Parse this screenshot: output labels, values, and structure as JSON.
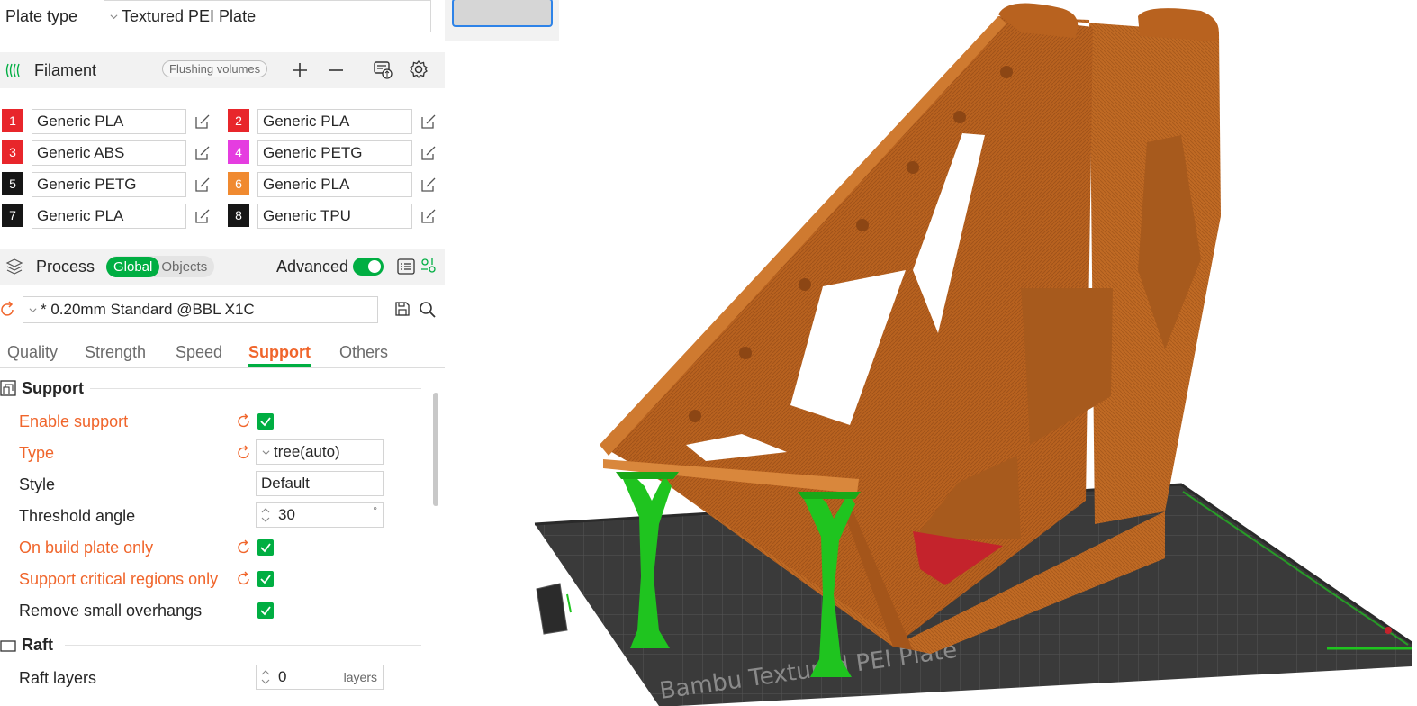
{
  "plate": {
    "label": "Plate type",
    "value": "Textured PEI Plate"
  },
  "filament": {
    "title": "Filament",
    "flushing_label": "Flushing volumes",
    "items": [
      {
        "num": "1",
        "name": "Generic PLA",
        "color": "#e8262b"
      },
      {
        "num": "2",
        "name": "Generic PLA",
        "color": "#e8262b"
      },
      {
        "num": "3",
        "name": "Generic ABS",
        "color": "#e8262b"
      },
      {
        "num": "4",
        "name": "Generic PETG",
        "color": "#e53de0"
      },
      {
        "num": "5",
        "name": "Generic PETG",
        "color": "#161616"
      },
      {
        "num": "6",
        "name": "Generic PLA",
        "color": "#f08a30"
      },
      {
        "num": "7",
        "name": "Generic PLA",
        "color": "#161616"
      },
      {
        "num": "8",
        "name": "Generic TPU",
        "color": "#161616"
      }
    ]
  },
  "process": {
    "title": "Process",
    "global_label": "Global",
    "objects_label": "Objects",
    "advanced_label": "Advanced",
    "preset": "* 0.20mm Standard @BBL X1C"
  },
  "tabs": [
    "Quality",
    "Strength",
    "Speed",
    "Support",
    "Others"
  ],
  "active_tab": "Support",
  "support": {
    "title": "Support",
    "enable_label": "Enable support",
    "type_label": "Type",
    "type_value": "tree(auto)",
    "style_label": "Style",
    "style_value": "Default",
    "threshold_label": "Threshold angle",
    "threshold_value": "30",
    "threshold_unit": "°",
    "build_plate_label": "On build plate only",
    "critical_label": "Support critical regions only",
    "remove_label": "Remove small overhangs"
  },
  "raft": {
    "title": "Raft",
    "layers_label": "Raft layers",
    "layers_value": "0",
    "layers_unit": "layers"
  },
  "viewport": {
    "plate_text": "Bambu Textured PEI Plate"
  },
  "colors": {
    "accent_green": "#00ae42",
    "modified_orange": "#f0652b",
    "model_orange": "#b8621f",
    "support_green": "#1fc41f",
    "overhang_red": "#c4232c",
    "bed_dark": "#3a3a3a"
  }
}
